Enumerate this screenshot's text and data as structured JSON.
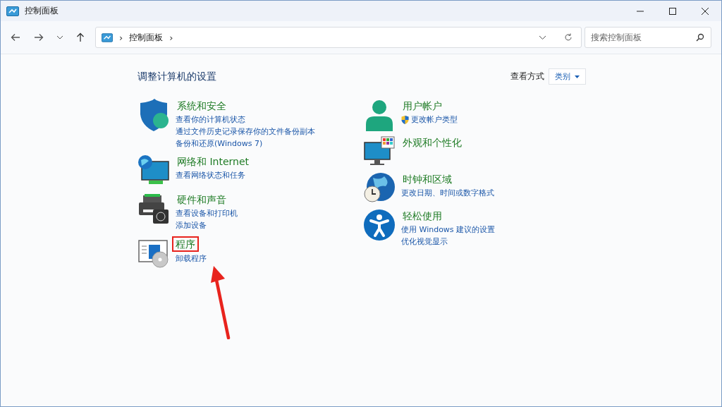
{
  "window": {
    "title": "控制面板"
  },
  "address_bar": {
    "path": "控制面板",
    "separator_before": "›",
    "separator_after": "›"
  },
  "search": {
    "placeholder": "搜索控制面板"
  },
  "heading": "调整计算机的设置",
  "view_by": {
    "label": "查看方式",
    "value": "类别"
  },
  "columns": [
    [
      {
        "kind": "security",
        "title": "系统和安全",
        "annotated": false,
        "links": [
          {
            "kind": "plain",
            "text": "查看你的计算机状态"
          },
          {
            "kind": "plain",
            "text": "通过文件历史记录保存你的文件备份副本"
          },
          {
            "kind": "plain",
            "text": "备份和还原(Windows 7)"
          }
        ]
      },
      {
        "kind": "network",
        "title": "网络和 Internet",
        "annotated": false,
        "links": [
          {
            "kind": "plain",
            "text": "查看网络状态和任务"
          }
        ]
      },
      {
        "kind": "hardware",
        "title": "硬件和声音",
        "annotated": false,
        "links": [
          {
            "kind": "plain",
            "text": "查看设备和打印机"
          },
          {
            "kind": "plain",
            "text": "添加设备"
          }
        ]
      },
      {
        "kind": "programs",
        "title": "程序",
        "annotated": true,
        "links": [
          {
            "kind": "plain",
            "text": "卸载程序"
          }
        ]
      }
    ],
    [
      {
        "kind": "user",
        "title": "用户帐户",
        "annotated": false,
        "links": [
          {
            "kind": "admin",
            "text": "更改帐户类型"
          }
        ]
      },
      {
        "kind": "appearance",
        "title": "外观和个性化",
        "annotated": false
      },
      {
        "kind": "clock",
        "title": "时钟和区域",
        "annotated": false,
        "links": [
          {
            "kind": "plain",
            "text": "更改日期、时间或数字格式"
          }
        ]
      },
      {
        "kind": "access",
        "title": "轻松使用",
        "annotated": false,
        "links": [
          {
            "kind": "plain",
            "text": "使用 Windows 建议的设置"
          },
          {
            "kind": "plain",
            "text": "优化视觉显示"
          }
        ]
      }
    ]
  ]
}
